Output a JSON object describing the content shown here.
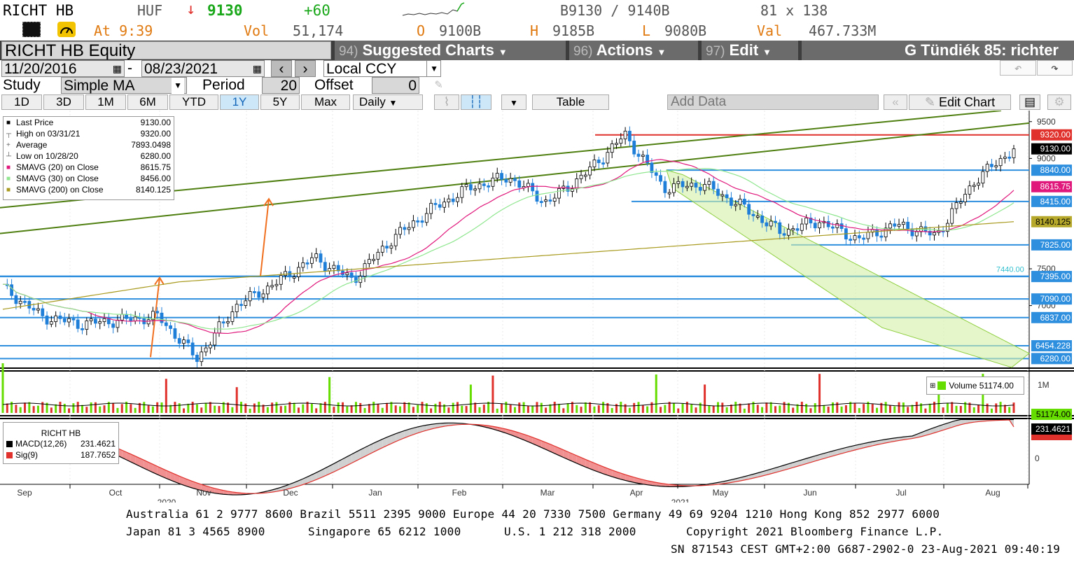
{
  "ticker_bar": {
    "ticker": "RICHT HB",
    "currency": "HUF",
    "arrow": "↓",
    "last": "9130",
    "change": "+60",
    "bid_ask": "B9130 / 9140B",
    "size": "81 x 138",
    "time_label": "At 9:39",
    "vol_label": "Vol",
    "vol_value": "51,174",
    "open_label": "O",
    "open_value": "9100B",
    "high_label": "H",
    "high_value": "9185B",
    "low_label": "L",
    "low_value": "9080B",
    "val_label": "Val",
    "val_value": "467.733M"
  },
  "menu": {
    "security": "RICHT HB Equity",
    "suggested_num": "94)",
    "suggested": "Suggested Charts",
    "actions_num": "96)",
    "actions": "Actions",
    "edit_num": "97)",
    "edit": "Edit",
    "title": "G Tündiék 85: richter"
  },
  "range": {
    "start": "11/20/2016",
    "end": "08/23/2021",
    "ccy": "Local CCY"
  },
  "study": {
    "label": "Study",
    "value": "Simple MA",
    "period_label": "Period",
    "period": "20",
    "offset_label": "Offset",
    "offset": "0"
  },
  "toolbar": {
    "periods": [
      "1D",
      "3D",
      "1M",
      "6M",
      "YTD",
      "1Y",
      "5Y",
      "Max"
    ],
    "active": "1Y",
    "freq": "Daily",
    "table": "Table",
    "add_data": "Add Data",
    "edit_chart": "Edit Chart"
  },
  "legend": {
    "items": [
      {
        "label": "Last Price",
        "value": "9130.00",
        "color": "#000000"
      },
      {
        "label": "High on 03/31/21",
        "value": "9320.00",
        "color": ""
      },
      {
        "label": "Average",
        "value": "7893.0498",
        "color": ""
      },
      {
        "label": "Low on 10/28/20",
        "value": "6280.00",
        "color": ""
      },
      {
        "label": "SMAVG (20)  on Close",
        "value": "8615.75",
        "color": "#e0187c"
      },
      {
        "label": "SMAVG (30)  on Close",
        "value": "8456.00",
        "color": "#8fe68f"
      },
      {
        "label": "SMAVG (200)  on Close",
        "value": "8140.125",
        "color": "#a89a1e"
      }
    ]
  },
  "price_tags": [
    {
      "text": "9320.00",
      "bg": "#e0312c",
      "fg": "#ffffff",
      "price": 9320
    },
    {
      "text": "9130.00",
      "bg": "#000000",
      "fg": "#ffffff",
      "price": 9130
    },
    {
      "text": "8840.00",
      "bg": "#2f8fdf",
      "fg": "#ffffff",
      "price": 8840
    },
    {
      "text": "8615.75",
      "bg": "#e0187c",
      "fg": "#ffffff",
      "price": 8615.75
    },
    {
      "text": "8415.00",
      "bg": "#2f8fdf",
      "fg": "#ffffff",
      "price": 8415
    },
    {
      "text": "8140.125",
      "bg": "#b5a82a",
      "fg": "#000000",
      "price": 8140.125
    },
    {
      "text": "7825.00",
      "bg": "#2f8fdf",
      "fg": "#ffffff",
      "price": 7825
    },
    {
      "text": "7395.00",
      "bg": "#2f8fdf",
      "fg": "#ffffff",
      "price": 7395
    },
    {
      "text": "7090.00",
      "bg": "#2f8fdf",
      "fg": "#ffffff",
      "price": 7090
    },
    {
      "text": "6837.00",
      "bg": "#2f8fdf",
      "fg": "#ffffff",
      "price": 6837
    },
    {
      "text": "6454.228",
      "bg": "#2f8fdf",
      "fg": "#ffffff",
      "price": 6454.228
    },
    {
      "text": "6280.00",
      "bg": "#2f8fdf",
      "fg": "#ffffff",
      "price": 6280
    }
  ],
  "price_axis_ticks": [
    "9500",
    "9000",
    "7500",
    "7000"
  ],
  "hline_label": "7440.00",
  "volume": {
    "legend": "Volume 51174.00",
    "tick": "1M",
    "tag": "51174.00"
  },
  "macd": {
    "title": "RICHT HB",
    "macd_label": "MACD(12,26)",
    "macd_value": "231.4621",
    "sig_label": "Sig(9)",
    "sig_value": "187.7652",
    "tag": "231.4621",
    "zero": "0"
  },
  "x_axis": {
    "months": [
      "Sep",
      "Oct",
      "Nov",
      "Dec",
      "Jan",
      "Feb",
      "Mar",
      "Apr",
      "May",
      "Jun",
      "Jul",
      "Aug"
    ],
    "years": [
      "2020",
      "2021"
    ]
  },
  "footer": {
    "line1": "Australia 61 2 9777 8600 Brazil 5511 2395 9000 Europe 44 20 7330 7500 Germany 49 69 9204 1210 Hong Kong 852 2977 6000",
    "line2a": "Japan 81 3 4565 8900",
    "line2b": "Singapore 65 6212 1000",
    "line2c": "U.S. 1 212 318 2000",
    "line2d": "Copyright 2021 Bloomberg Finance L.P.",
    "line3": "SN 871543 CEST GMT+2:00 G687-2902-0 23-Aug-2021 09:40:19"
  },
  "chart_data": {
    "type": "candlestick",
    "x": [
      "2020-08-24",
      "2020-09-07",
      "2020-09-21",
      "2020-10-05",
      "2020-10-19",
      "2020-10-28",
      "2020-11-09",
      "2020-11-23",
      "2020-12-07",
      "2020-12-21",
      "2021-01-04",
      "2021-01-18",
      "2021-02-01",
      "2021-02-15",
      "2021-03-01",
      "2021-03-15",
      "2021-03-31",
      "2021-04-12",
      "2021-04-26",
      "2021-05-10",
      "2021-05-24",
      "2021-06-07",
      "2021-06-21",
      "2021-07-05",
      "2021-07-19",
      "2021-08-02",
      "2021-08-23"
    ],
    "close": [
      7250,
      6850,
      6750,
      6800,
      6850,
      6280,
      7000,
      7300,
      7650,
      7350,
      7900,
      8300,
      8600,
      8750,
      8400,
      8800,
      9320,
      8600,
      8650,
      8350,
      8000,
      8150,
      7900,
      8100,
      7950,
      8700,
      9130
    ],
    "sma20_last": 8615.75,
    "sma30_last": 8456.0,
    "sma200_last": 8140.125,
    "high": 9320.0,
    "low": 6280.0,
    "average": 7893.0498,
    "ylim": [
      6150,
      9650
    ]
  }
}
